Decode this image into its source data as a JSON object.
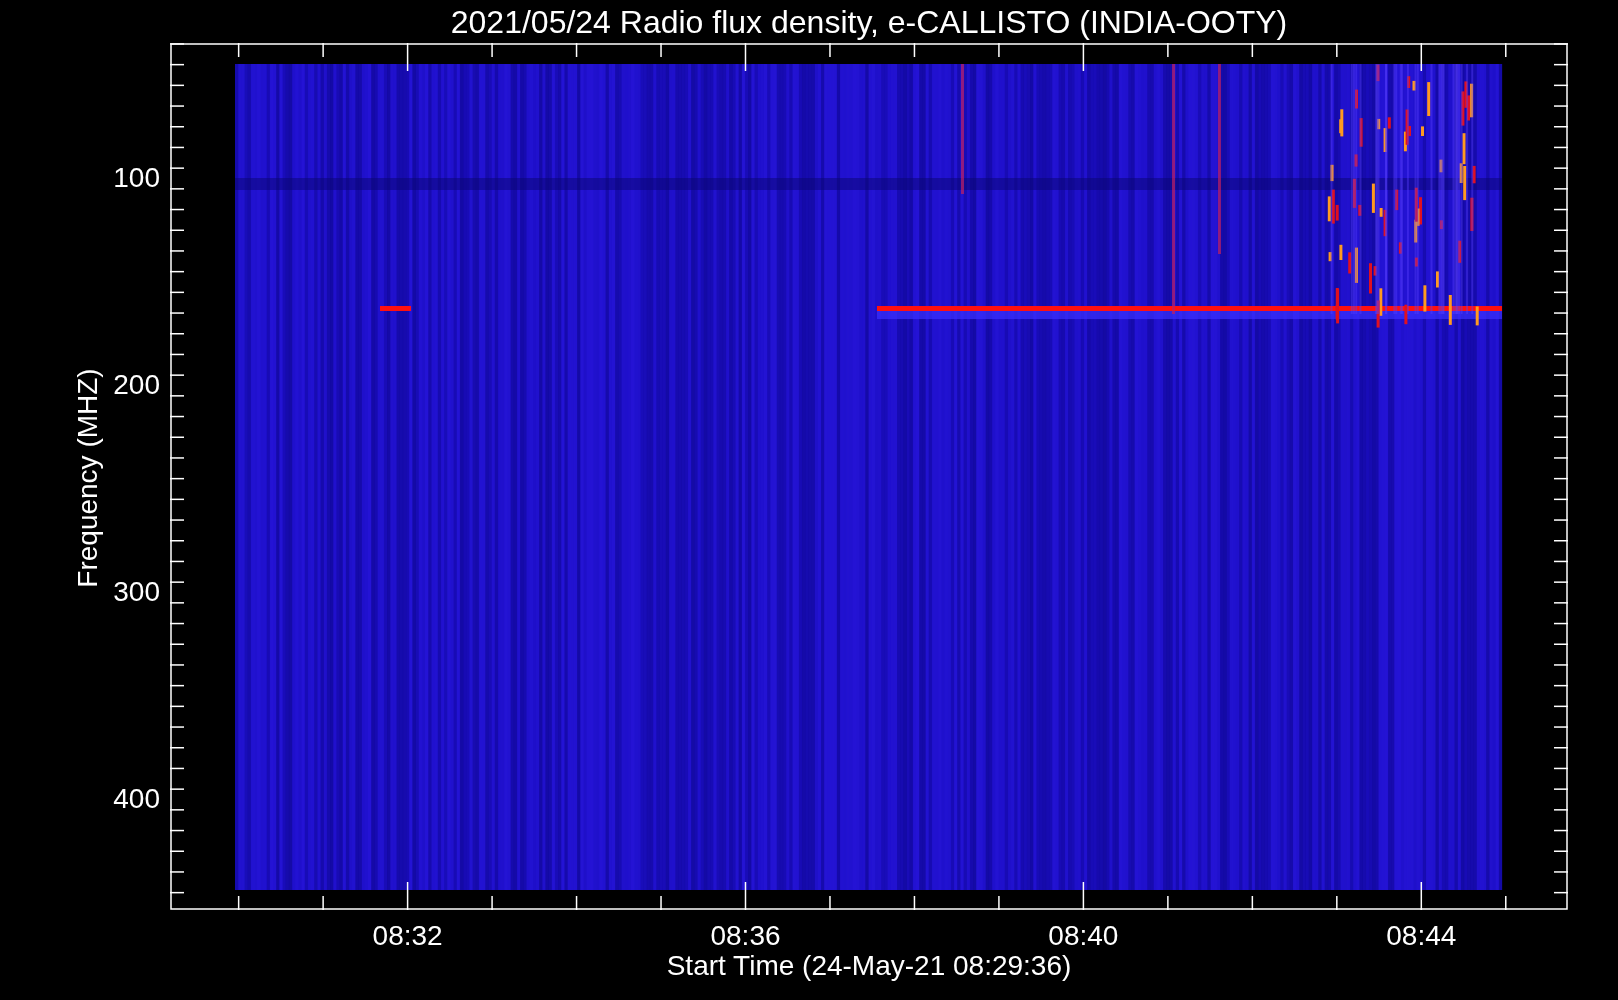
{
  "title": "2021/05/24  Radio flux density, e-CALLISTO (INDIA-OOTY)",
  "y_label": "Frequency (MHZ)",
  "y_ticks": [
    "100",
    "200",
    "300",
    "400"
  ],
  "x_ticks": [
    "08:32",
    "08:36",
    "08:40",
    "08:44"
  ],
  "x_label": "Start Time (24-May-21 08:29:36)"
}
